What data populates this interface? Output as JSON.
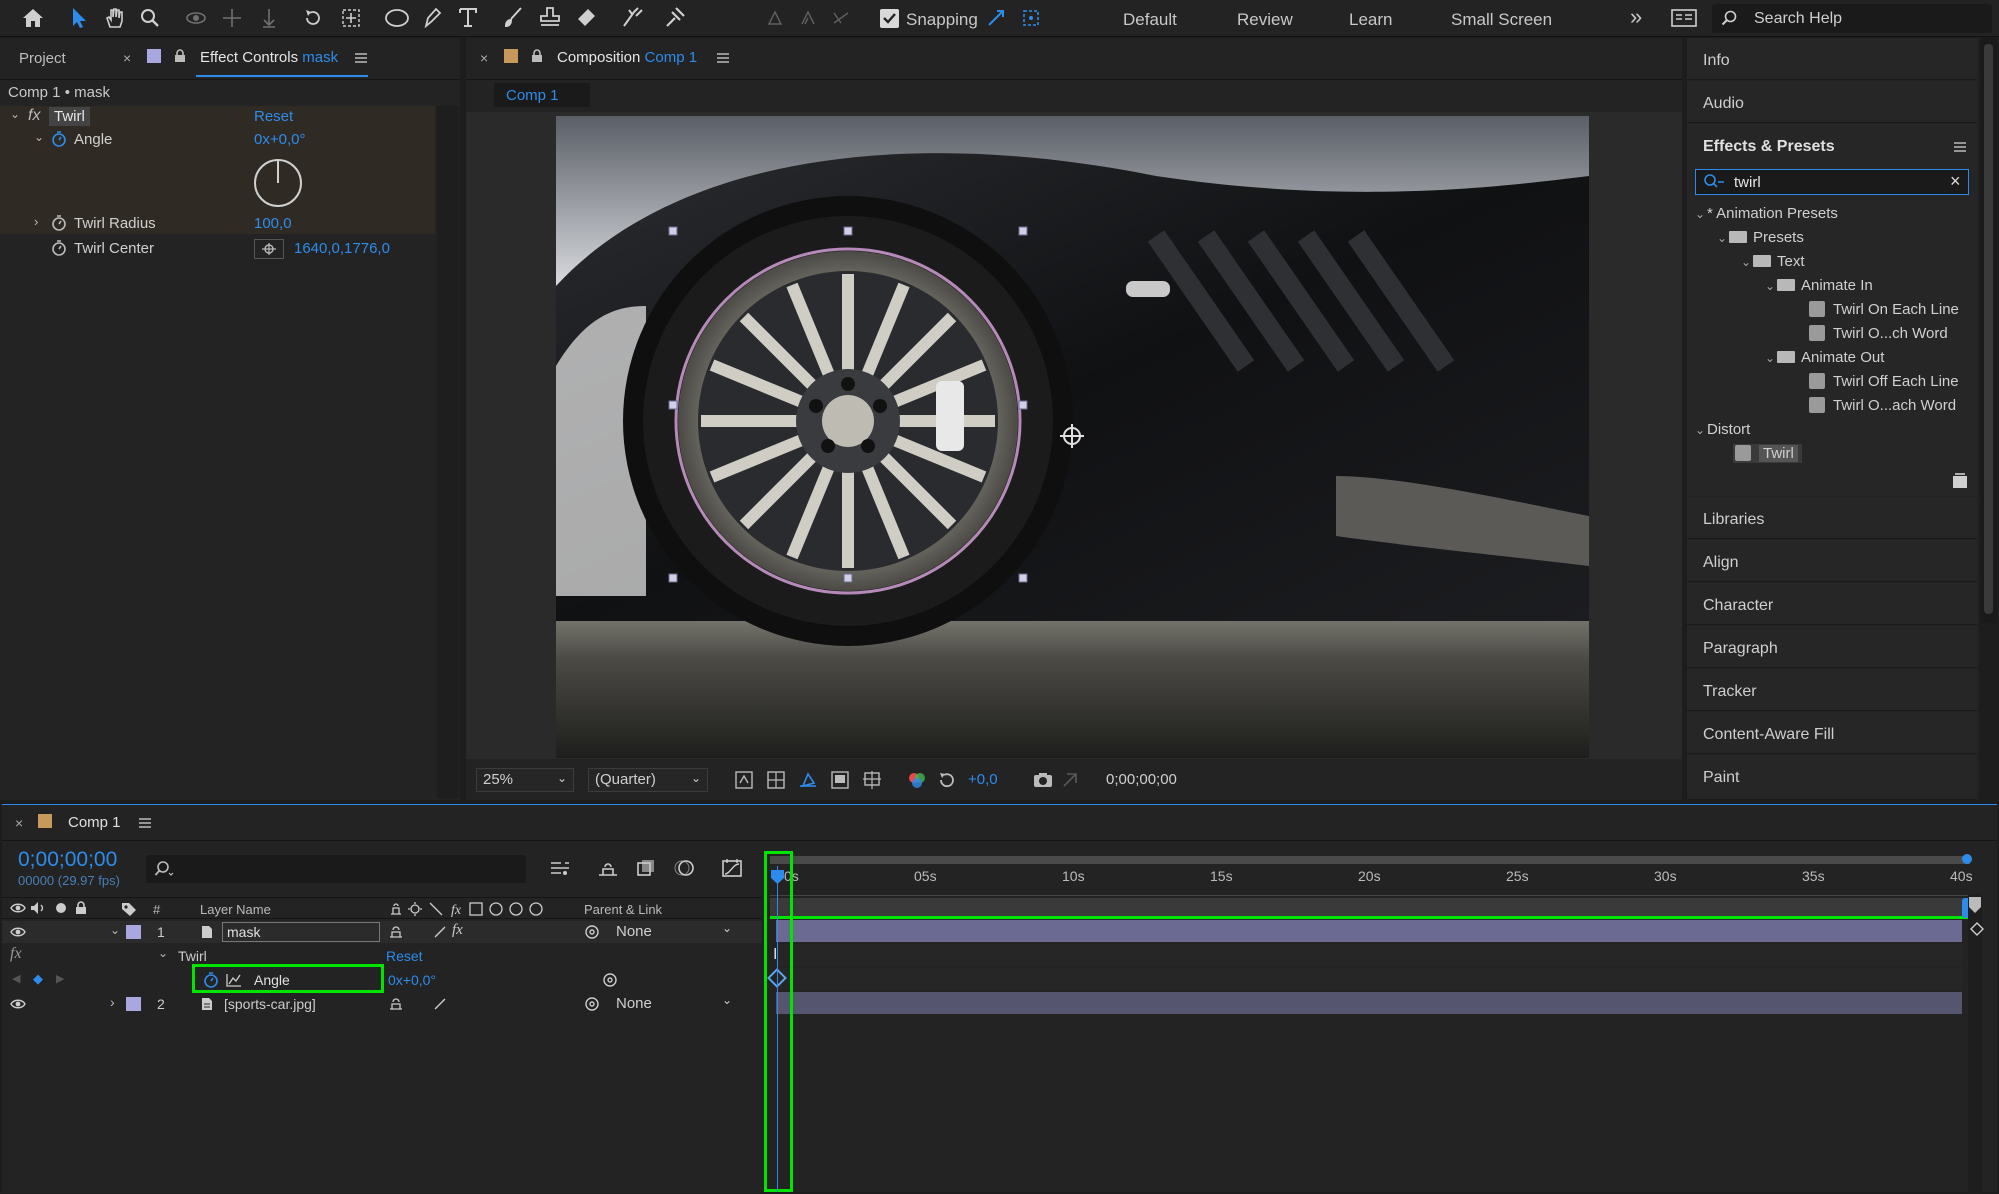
{
  "toolbar": {
    "snapping_label": "Snapping",
    "workspaces": [
      "Default",
      "Review",
      "Learn",
      "Small Screen"
    ],
    "more_symbol": "»",
    "search_help_placeholder": "Search Help"
  },
  "effect_controls": {
    "tab_project": "Project",
    "tab_effect_controls": "Effect Controls",
    "tab_layer": "mask",
    "breadcrumb": "Comp 1 • mask",
    "effect_name": "Twirl",
    "fx_label": "fx",
    "reset_label": "Reset",
    "angle_label": "Angle",
    "angle_value": "0x+0,0°",
    "radius_label": "Twirl Radius",
    "radius_value": "100,0",
    "center_label": "Twirl Center",
    "center_value": "1640,0,1776,0"
  },
  "composition": {
    "tab_label": "Composition",
    "comp_name": "Comp 1",
    "subtab": "Comp 1",
    "zoom": "25%",
    "resolution": "(Quarter)",
    "exposure": "+0,0",
    "timecode": "0;00;00;00"
  },
  "right_panel": {
    "info": "Info",
    "audio": "Audio",
    "effects_presets": "Effects & Presets",
    "search_value": "twirl",
    "tree": {
      "animation_presets": "* Animation Presets",
      "presets": "Presets",
      "text": "Text",
      "animate_in": "Animate In",
      "twirl_on_each_line": "Twirl On Each Line",
      "twirl_on_each_word": "Twirl O...ch Word",
      "animate_out": "Animate Out",
      "twirl_off_each_line": "Twirl Off Each Line",
      "twirl_off_each_word": "Twirl O...ach Word",
      "distort": "Distort",
      "twirl": "Twirl"
    },
    "panels": [
      "Libraries",
      "Align",
      "Character",
      "Paragraph",
      "Tracker",
      "Content-Aware Fill",
      "Paint"
    ]
  },
  "timeline": {
    "tab": "Comp 1",
    "timecode": "0;00;00;00",
    "frames": "00000 (29.97 fps)",
    "col_hash": "#",
    "col_layer_name": "Layer Name",
    "col_parent": "Parent & Link",
    "layers": [
      {
        "num": "1",
        "name": "mask",
        "parent": "None"
      },
      {
        "num": "2",
        "name": "[sports-car.jpg]",
        "parent": "None"
      }
    ],
    "fx_label": "fx",
    "effect": "Twirl",
    "reset": "Reset",
    "property": "Angle",
    "property_value": "0x+0,0°",
    "ruler": [
      "0s",
      "05s",
      "10s",
      "15s",
      "20s",
      "25s",
      "30s",
      "35s",
      "40s"
    ]
  },
  "colors": {
    "accent": "#2d8ceb",
    "highlight": "#00e400",
    "layer_label": "#a9a7e0"
  }
}
